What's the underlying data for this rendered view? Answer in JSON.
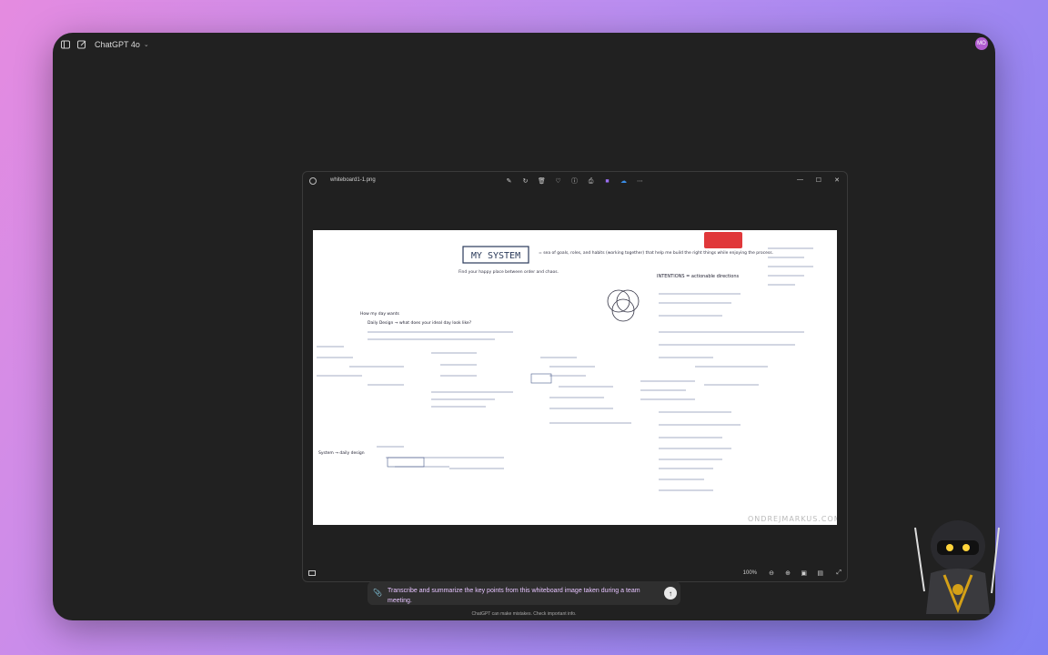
{
  "header": {
    "model_name": "ChatGPT 4o",
    "avatar_initials": "MO"
  },
  "viewer": {
    "file_name": "whiteboard1-1.png",
    "zoom": "100%"
  },
  "whiteboard": {
    "title": "MY SYSTEM",
    "title_note": "= sea of goals, roles, and habits (working together) that help me build the right things while enjoying the process.",
    "subtitle": "Find your happy place between order and chaos.",
    "intentions": "INTENTIONS = actionable directions",
    "day_wants": "How my day wants",
    "daily_design": "Daily Design → what does your ideal day look like?",
    "system": "System → daily design",
    "watermark": "ONDREJMARKUS.COM"
  },
  "prompt": {
    "text": "Transcribe and summarize the key points from this whiteboard image taken during a team meeting."
  },
  "footer": {
    "disclaimer": "ChatGPT can make mistakes. Check important info."
  },
  "colors": {
    "accent": "#b05ccf",
    "prompt_text": "#e6c4ff"
  }
}
